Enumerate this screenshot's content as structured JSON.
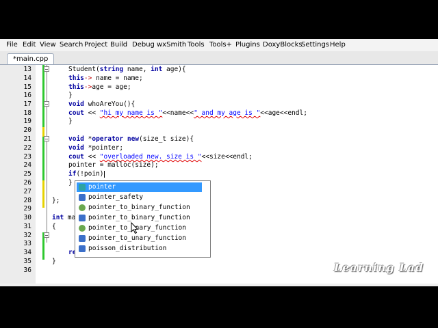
{
  "menu": [
    "File",
    "Edit",
    "View",
    "Search",
    "Project",
    "Build",
    "Debug",
    "wxSmith",
    "Tools",
    "Tools+",
    "Plugins",
    "DoxyBlocks",
    "Settings",
    "Help"
  ],
  "tab": {
    "label": "*main.cpp"
  },
  "line_numbers": [
    "13",
    "14",
    "15",
    "16",
    "17",
    "18",
    "19",
    "20",
    "21",
    "22",
    "23",
    "24",
    "25",
    "26",
    "27",
    "28",
    "29",
    "30",
    "31",
    "32",
    "33",
    "34",
    "35",
    "36"
  ],
  "code": {
    "l13_a": "Student(",
    "l13_ty1": "string",
    "l13_b": " name, ",
    "l13_kw1": "int",
    "l13_c": " age){",
    "l14_kw": "this",
    "l14_op": "->",
    "l14_rest": " name = name;",
    "l15_kw": "this",
    "l15_op": "->",
    "l15_rest": "age = age;",
    "l16": "}",
    "l17_kw": "void",
    "l17_rest": " whoAreYou(){",
    "l18_kw": "cout",
    "l18_a": " << ",
    "l18_str1": "\"hi my name is \"",
    "l18_b": "<<name<<",
    "l18_str2": "\" and my age is \"",
    "l18_c": "<<age<<endl;",
    "l19": "}",
    "l21_kw1": "void",
    "l21_a": " *",
    "l21_kw2": "operator",
    "l21_b": " ",
    "l21_kw3": "new",
    "l21_c": "(size_t size){",
    "l22_kw": "void",
    "l22_rest": " *pointer;",
    "l23_kw": "cout",
    "l23_a": " << ",
    "l23_str": "\"overloaded new. size is \"",
    "l23_b": "<<size<<endl;",
    "l24": "pointer = malloc(size);",
    "l25_kw": "if",
    "l25_rest": "(!poin)",
    "l26": "}",
    "l29": "};",
    "l31_kw": "int",
    "l31_rest": " ma",
    "l32": "{",
    "l35_kw": "return",
    "l35_rest": " 0;",
    "l36": "}"
  },
  "autocomplete": {
    "items": [
      {
        "label": "pointer",
        "icon": "variable-icon"
      },
      {
        "label": "pointer_safety",
        "icon": "class-icon"
      },
      {
        "label": "pointer_to_binary_function",
        "icon": "function-icon"
      },
      {
        "label": "pointer_to_binary_function",
        "icon": "class-icon"
      },
      {
        "label": "pointer_to_unary_function",
        "icon": "function-icon"
      },
      {
        "label": "pointer_to_unary_function",
        "icon": "class-icon"
      },
      {
        "label": "poisson_distribution",
        "icon": "class-icon"
      }
    ]
  },
  "watermark": "Learning Lad",
  "colors": {
    "keyword": "#0000a0",
    "string": "#0000ff",
    "selection": "#3399ff",
    "changebar_saved": "#2ec82e",
    "changebar_modified": "#e6d200"
  }
}
